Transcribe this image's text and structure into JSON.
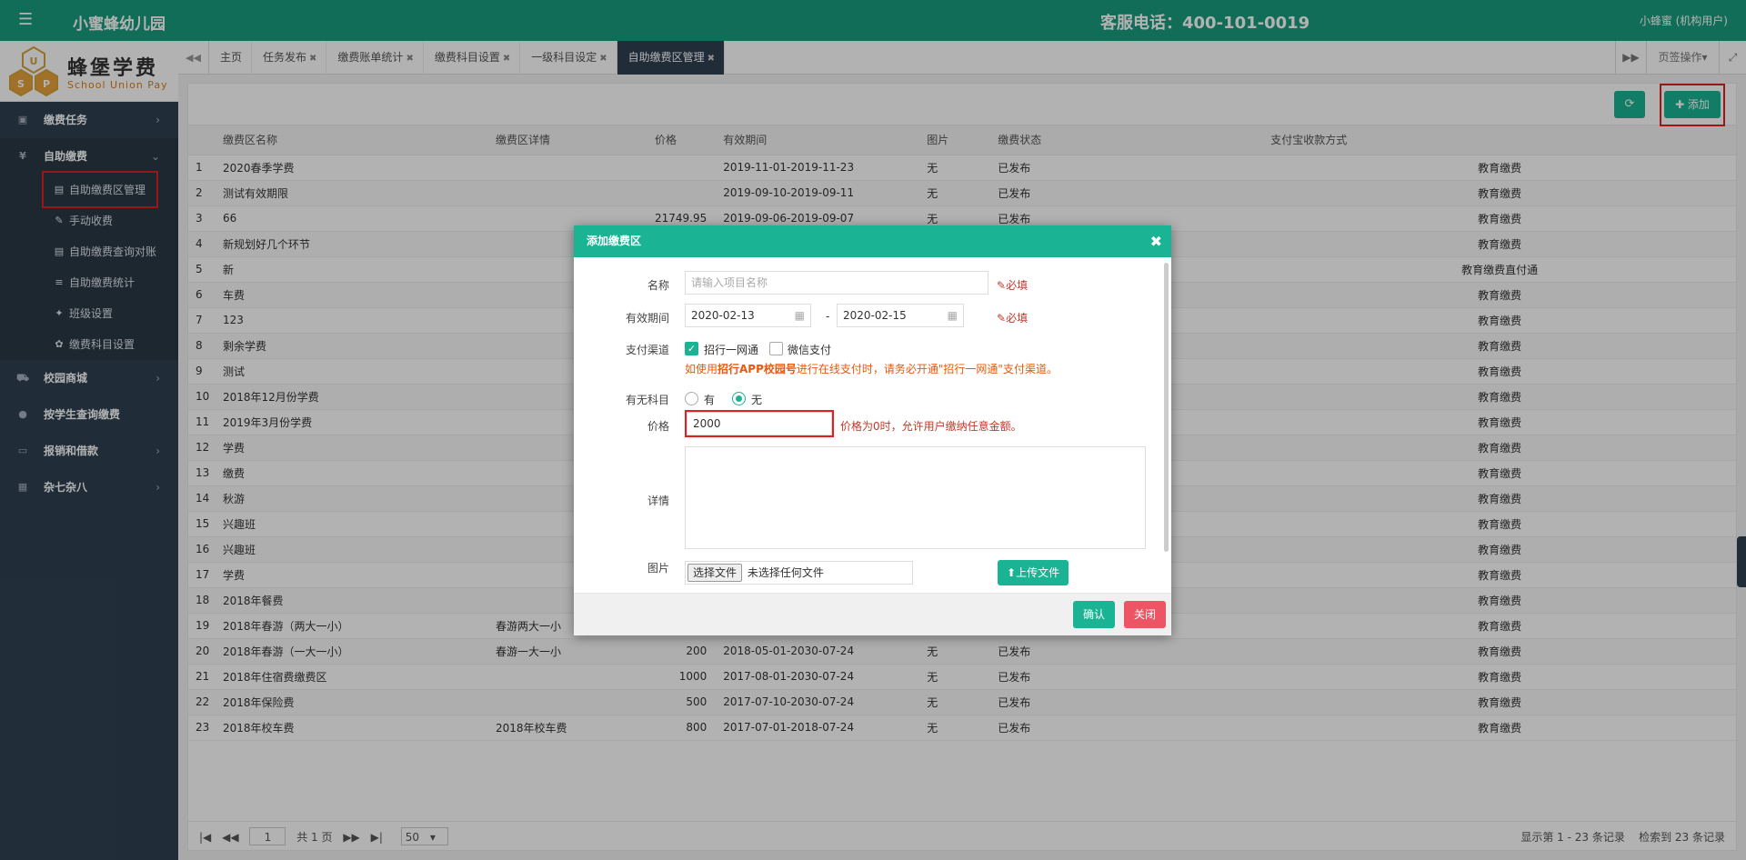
{
  "topbar": {
    "menu_icon": "☰",
    "app_title": "小蜜蜂幼儿园",
    "hotline": "客服电话：400-101-0019",
    "user": "小蜂蜜 (机构用户)"
  },
  "logo": {
    "brand_cn": "蜂堡学费",
    "brand_en": "School Union Pay",
    "hex_letters": [
      "U",
      "S",
      "P"
    ]
  },
  "sidebar": {
    "groups": [
      {
        "label": "缴费任务",
        "icon": "▣"
      },
      {
        "label": "自助缴费",
        "icon": "¥"
      },
      {
        "label": "校园商城",
        "icon": "⛟"
      },
      {
        "label": "按学生查询缴费",
        "icon": "●"
      },
      {
        "label": "报销和借款",
        "icon": "▭"
      },
      {
        "label": "杂七杂八",
        "icon": "▦"
      }
    ],
    "subitems": [
      {
        "label": "自助缴费区管理",
        "icon": "▤"
      },
      {
        "label": "手动收费",
        "icon": "✎"
      },
      {
        "label": "自助缴费查询对账",
        "icon": "▤"
      },
      {
        "label": "自助缴费统计",
        "icon": "≡"
      },
      {
        "label": "班级设置",
        "icon": "✦"
      },
      {
        "label": "缴费科目设置",
        "icon": "✿"
      }
    ]
  },
  "tabs": {
    "items": [
      "主页",
      "任务发布",
      "缴费账单统计",
      "缴费科目设置",
      "一级科目设定",
      "自助缴费区管理"
    ],
    "close_glyph": "✖",
    "page_ops": "页签操作▾"
  },
  "toolbar": {
    "add_label": "✚ 添加"
  },
  "table": {
    "headers": [
      "",
      "缴费区名称",
      "缴费区详情",
      "价格",
      "有效期间",
      "图片",
      "缴费状态",
      "支付宝收款方式"
    ],
    "rows": [
      [
        "1",
        "2020春季学费",
        "",
        "",
        "2019-11-01-2019-11-23",
        "无",
        "已发布",
        "教育缴费"
      ],
      [
        "2",
        "测试有效期限",
        "",
        "",
        "2019-09-10-2019-09-11",
        "无",
        "已发布",
        "教育缴费"
      ],
      [
        "3",
        "66",
        "",
        "21749.95",
        "2019-09-06-2019-09-07",
        "无",
        "已发布",
        "教育缴费"
      ],
      [
        "4",
        "新规划好几个环节",
        "",
        "",
        "",
        "",
        "",
        "教育缴费"
      ],
      [
        "5",
        "新",
        "",
        "",
        "",
        "",
        "",
        "教育缴费直付通"
      ],
      [
        "6",
        "车费",
        "",
        "",
        "",
        "",
        "",
        "教育缴费"
      ],
      [
        "7",
        "123",
        "",
        "",
        "",
        "",
        "",
        "教育缴费"
      ],
      [
        "8",
        "剩余学费",
        "",
        "",
        "",
        "",
        "",
        "教育缴费"
      ],
      [
        "9",
        "测试",
        "",
        "",
        "",
        "",
        "",
        "教育缴费"
      ],
      [
        "10",
        "2018年12月份学费",
        "",
        "",
        "",
        "",
        "",
        "教育缴费"
      ],
      [
        "11",
        "2019年3月份学费",
        "",
        "",
        "",
        "",
        "",
        "教育缴费"
      ],
      [
        "12",
        "学费",
        "",
        "",
        "",
        "",
        "",
        "教育缴费"
      ],
      [
        "13",
        "缴费",
        "",
        "",
        "",
        "",
        "",
        "教育缴费"
      ],
      [
        "14",
        "秋游",
        "",
        "",
        "",
        "",
        "",
        "教育缴费"
      ],
      [
        "15",
        "兴趣班",
        "",
        "",
        "",
        "",
        "",
        "教育缴费"
      ],
      [
        "16",
        "兴趣班",
        "",
        "",
        "",
        "",
        "",
        "教育缴费"
      ],
      [
        "17",
        "学费",
        "",
        "",
        "",
        "",
        "",
        "教育缴费"
      ],
      [
        "18",
        "2018年餐费",
        "",
        "",
        "",
        "",
        "",
        "教育缴费"
      ],
      [
        "19",
        "2018年春游（两大一小）",
        "春游两大一小",
        "",
        "",
        "",
        "",
        "教育缴费"
      ],
      [
        "20",
        "2018年春游（一大一小）",
        "春游一大一小",
        "200",
        "2018-05-01-2030-07-24",
        "无",
        "已发布",
        "教育缴费"
      ],
      [
        "21",
        "2018年住宿费缴费区",
        "",
        "1000",
        "2017-08-01-2030-07-24",
        "无",
        "已发布",
        "教育缴费"
      ],
      [
        "22",
        "2018年保险费",
        "",
        "500",
        "2017-07-10-2030-07-24",
        "无",
        "已发布",
        "教育缴费"
      ],
      [
        "23",
        "2018年校车费",
        "2018年校车费",
        "800",
        "2017-07-01-2018-07-24",
        "无",
        "已发布",
        "教育缴费"
      ]
    ]
  },
  "pager": {
    "current_page": "1",
    "total_pages": "共 1 页",
    "page_size": "50",
    "info_left": "显示第 1 - 23 条记录",
    "info_right": "检索到 23 条记录"
  },
  "modal": {
    "title": "添加缴费区",
    "name_label": "名称",
    "name_placeholder": "请输入项目名称",
    "required_text": "必填",
    "period_label": "有效期间",
    "date_start": "2020-02-13",
    "date_sep": "-",
    "date_end": "2020-02-15",
    "channel_label": "支付渠道",
    "channel_zhaohang": "招行一网通",
    "channel_wechat": "微信支付",
    "warn_pre": "如使用",
    "warn_bold": "招行APP校园号",
    "warn_post": "进行在线支付时，请务必开通\"招行一网通\"支付渠道。",
    "subject_label": "有无科目",
    "subject_yes": "有",
    "subject_no": "无",
    "price_label": "价格",
    "price_value": "2000",
    "price_hint": "价格为0时，允许用户缴纳任意金额。",
    "detail_label": "详情",
    "image_label": "图片",
    "choose_file": "选择文件",
    "no_file": "未选择任何文件",
    "upload_label": "上传文件",
    "ok_label": "确认",
    "cancel_label": "关闭"
  }
}
